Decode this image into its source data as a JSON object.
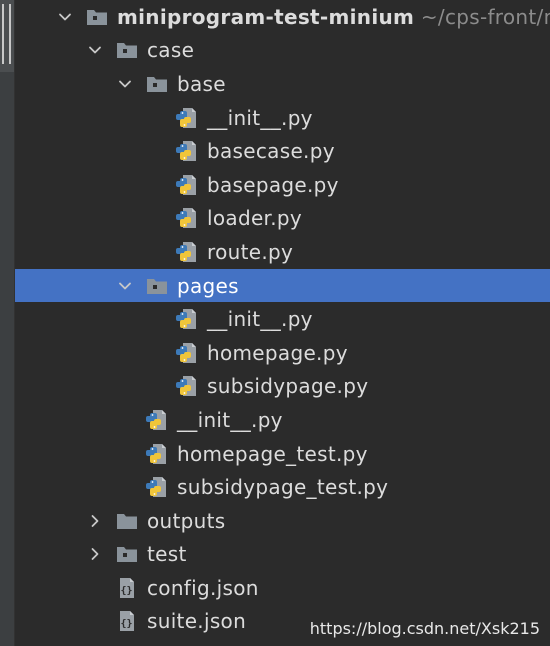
{
  "tree": [
    {
      "label": "miniprogram-test-minium",
      "path": "~/cps-front/mi",
      "type": "folder",
      "expanded": true,
      "bold": true,
      "depth": 0
    },
    {
      "label": "case",
      "type": "folder",
      "expanded": true,
      "depth": 1
    },
    {
      "label": "base",
      "type": "folder",
      "expanded": true,
      "depth": 2
    },
    {
      "label": "__init__.py",
      "type": "py",
      "depth": 3
    },
    {
      "label": "basecase.py",
      "type": "py",
      "depth": 3
    },
    {
      "label": "basepage.py",
      "type": "py",
      "depth": 3
    },
    {
      "label": "loader.py",
      "type": "py",
      "depth": 3
    },
    {
      "label": "route.py",
      "type": "py",
      "depth": 3
    },
    {
      "label": "pages",
      "type": "folder",
      "expanded": true,
      "selected": true,
      "depth": 2
    },
    {
      "label": "__init__.py",
      "type": "py",
      "depth": 3
    },
    {
      "label": "homepage.py",
      "type": "py",
      "depth": 3
    },
    {
      "label": "subsidypage.py",
      "type": "py",
      "depth": 3
    },
    {
      "label": "__init__.py",
      "type": "py",
      "depth": 2
    },
    {
      "label": "homepage_test.py",
      "type": "py",
      "depth": 2
    },
    {
      "label": "subsidypage_test.py",
      "type": "py",
      "depth": 2
    },
    {
      "label": "outputs",
      "type": "folder",
      "expanded": false,
      "plain": true,
      "depth": 1
    },
    {
      "label": "test",
      "type": "folder",
      "expanded": false,
      "depth": 1
    },
    {
      "label": "config.json",
      "type": "json",
      "depth": 1
    },
    {
      "label": "suite.json",
      "type": "json",
      "depth": 1
    }
  ],
  "watermark": "https://blog.csdn.net/Xsk215",
  "colors": {
    "background": "#2b2b2b",
    "selection": "#4472c4",
    "text": "#dcdcdc",
    "folder": "#8a939b",
    "python_blue": "#3d7ab8",
    "python_yellow": "#f0c53a"
  },
  "icons": {
    "folder": "folder-icon",
    "package": "package-folder-icon",
    "py": "python-file-icon",
    "json": "json-file-icon",
    "expanded": "chevron-down-icon",
    "collapsed": "chevron-right-icon"
  }
}
